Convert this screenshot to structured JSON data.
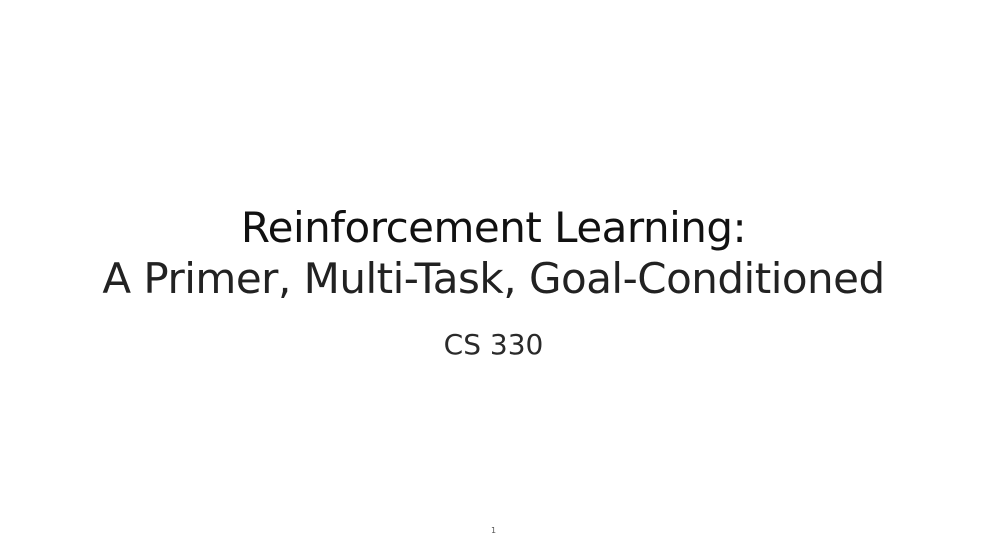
{
  "slide": {
    "title_line1": "Reinforcement Learning:",
    "title_line2": "A Primer, Multi-Task, Goal-Conditioned",
    "course": "CS 330",
    "page_number": "1"
  }
}
